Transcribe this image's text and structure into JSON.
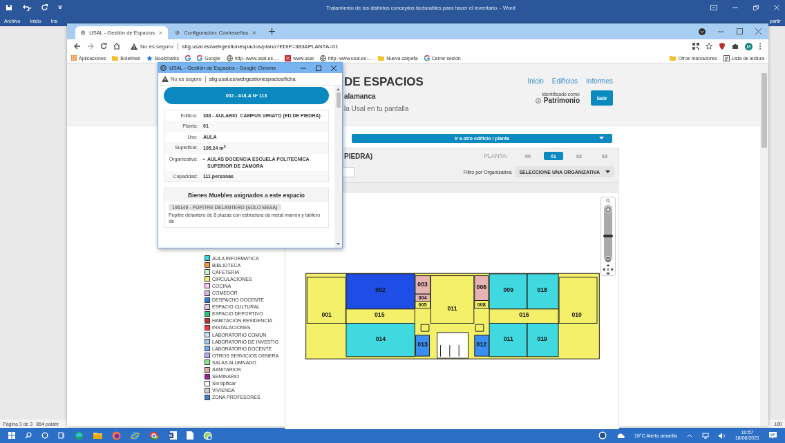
{
  "word": {
    "title": "Tratamiento de los distintos conceptos facturables para hacer el inventario. - Word",
    "ribbon_tabs": [
      "Archivo",
      "Inicio",
      "Ins"
    ],
    "share": "partir",
    "status": {
      "page": "Página 3 de 3",
      "words": "864 palabr",
      "zoom": "180"
    }
  },
  "browser": {
    "tabs": [
      {
        "label": "USAL - Gestión de Espacios",
        "selected": true
      },
      {
        "label": "Configuración: Contraseñas",
        "selected": false
      }
    ],
    "security": "No es seguro",
    "url": "stig.usal.es/webgestionespacios/plano?EDIF=383&PLANTA=01",
    "profile": "M",
    "bookmarks": [
      {
        "label": "Aplicaciones",
        "kind": "apps"
      },
      {
        "label": "Boletines",
        "kind": "folder"
      },
      {
        "label": "Bookmarks",
        "kind": "star"
      },
      {
        "kind": "google"
      },
      {
        "label": "Google",
        "kind": "google"
      },
      {
        "label": "http--www.usal.es-...",
        "kind": "globe"
      },
      {
        "label": "www.usal",
        "kind": "site"
      },
      {
        "label": "http--www.usal.es-...",
        "kind": "globe"
      },
      {
        "label": "Nueva carpeta",
        "kind": "folder"
      },
      {
        "label": "Cerrar sesión",
        "kind": "google"
      }
    ],
    "bookmarks_right": [
      {
        "label": "Otros marcadores",
        "kind": "folder"
      },
      {
        "label": "Lista de lectura",
        "kind": "list"
      }
    ]
  },
  "page": {
    "header": {
      "title": "DE ESPACIOS",
      "subtitle": "alamanca",
      "tagline": "la Usal en tu pantalla",
      "nav": [
        "Inicio",
        "Edificios",
        "Informes"
      ],
      "identified_as": "Identificado como",
      "user": "Patrimonio",
      "logout": "Salir"
    },
    "building_selector": "Ir a otro edificio / planta",
    "building_name": "PIEDRA)",
    "floor_label": "PLANTA:",
    "floors": [
      {
        "label": "00",
        "selected": false
      },
      {
        "label": "01",
        "selected": true
      },
      {
        "label": "02",
        "selected": false
      },
      {
        "label": "03",
        "selected": false
      }
    ],
    "filter": {
      "label": "Filtro por Organizativa:",
      "value": "SELECCIONE UNA ORGANIZATIVA"
    },
    "legend": [
      {
        "label": "AULA INFORMATICA",
        "color": "#33d6e6"
      },
      {
        "label": "BIBLIOTECA",
        "color": "#f59a30"
      },
      {
        "label": "CAFETERIA",
        "color": "#ccf5cc"
      },
      {
        "label": "CIRCULACIONES",
        "color": "#f0f070"
      },
      {
        "label": "COCINA",
        "color": "#ffc8f0"
      },
      {
        "label": "COMEDOR",
        "color": "#e0b0e8"
      },
      {
        "label": "DESPACHO DOCENTE",
        "color": "#2f7de0"
      },
      {
        "label": "ESPACIO CULTURAL",
        "color": "#e8c8f0"
      },
      {
        "label": "ESPACIO DEPORTIVO",
        "color": "#22cc77"
      },
      {
        "label": "HABITACION RESIDENCIA",
        "color": "#bb3333"
      },
      {
        "label": "INSTALACIONES",
        "color": "#ff3333"
      },
      {
        "label": "LABORATORIO COMUN",
        "color": "#c8e0f8"
      },
      {
        "label": "LABORATORIO DE INVESTIG",
        "color": "#a0c8f0"
      },
      {
        "label": "LABORATORIO DOCENTE",
        "color": "#6aaaf0"
      },
      {
        "label": "OTROS SERVICIOS GENERA",
        "color": "#b0b0f8"
      },
      {
        "label": "SALAS ALUMNADO",
        "color": "#88ee88"
      },
      {
        "label": "SANITARIOS",
        "color": "#e8a8a8"
      },
      {
        "label": "SEMINARIO",
        "color": "#a020a0"
      },
      {
        "label": "Sin tipificar",
        "color": "#ffffff"
      },
      {
        "label": "VIVIENDA",
        "color": "#d0d0d0"
      },
      {
        "label": "ZONA PROFESORES",
        "color": "#4080d0"
      }
    ],
    "map_zoom": {
      "level": 0.47
    },
    "rooms": [
      {
        "label": "002",
        "color": "#1f4ee6"
      },
      {
        "label": "003",
        "color": "#e6b3b3"
      },
      {
        "label": "004",
        "color": "#e6b3b3"
      },
      {
        "label": "005",
        "color": "#f5f06a"
      },
      {
        "label": "011",
        "color": "#f5f06a"
      },
      {
        "label": "006",
        "color": "#e6b3b3"
      },
      {
        "label": "008",
        "color": "#f5f06a"
      },
      {
        "label": "009",
        "color": "#40d9e0"
      },
      {
        "label": "018",
        "color": "#40d9e0"
      },
      {
        "label": "001",
        "color": "#f5f06a"
      },
      {
        "label": "015",
        "color": "#f5f06a"
      },
      {
        "label": "016",
        "color": "#f5f06a"
      },
      {
        "label": "010",
        "color": "#f5f06a"
      },
      {
        "label": "014",
        "color": "#40d9e0"
      },
      {
        "label": "013",
        "color": "#3b8ff0"
      },
      {
        "label": "012",
        "color": "#3b8ff0"
      },
      {
        "label": "011",
        "color": "#40d9e0"
      },
      {
        "label": "019",
        "color": "#40d9e0"
      }
    ]
  },
  "popup": {
    "title": "USAL - Gestión de Espacios - Google Chrome",
    "security": "No es seguro",
    "url": "stig.usal.es/webgestionespacios/ficha",
    "space": "002 - AULA Nº 113",
    "fields": [
      {
        "label": "Edificio:",
        "value": "383 - AULARIO. CAMPUS VIRIATO (ED.DE PIEDRA)"
      },
      {
        "label": "Planta:",
        "value": "01"
      },
      {
        "label": "Uso:",
        "value": "AULA"
      },
      {
        "label": "Superficie:",
        "value": "105.24 m$^{2}$"
      },
      {
        "label": "Organizativa:",
        "items": [
          "AULAS DOCENCIA ESCUELA POLITECNICA SUPERIOR DE ZAMORA"
        ]
      },
      {
        "label": "Capacidad:",
        "value": "111 personas"
      }
    ],
    "assets_title": "Bienes Muebles asignados a este espacio",
    "assets": [
      {
        "code": "196149 - PUPITRE DELANTERO (SOLO MESA)",
        "description": "Pupitre delantero de 8 plazas con estructura de metal marrón y tablero de"
      }
    ]
  },
  "taskbar": {
    "weather": "15°C Alerta amarilla",
    "time": "10:57",
    "date": "18/06/2021"
  }
}
